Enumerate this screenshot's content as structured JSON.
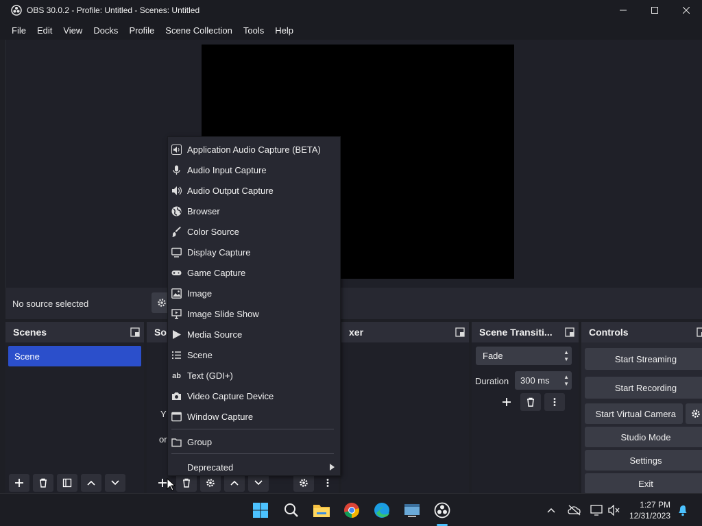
{
  "window": {
    "title": "OBS 30.0.2 - Profile: Untitled - Scenes: Untitled"
  },
  "menu": [
    "File",
    "Edit",
    "View",
    "Docks",
    "Profile",
    "Scene Collection",
    "Tools",
    "Help"
  ],
  "source_bar": {
    "status": "No source selected"
  },
  "docks": {
    "scenes": {
      "title": "Scenes",
      "items": [
        "Scene"
      ]
    },
    "sources": {
      "title_partial": "So",
      "hint_partial_1": "Y",
      "hint_partial_2": "or"
    },
    "mixer": {
      "title_partial": "xer"
    },
    "transitions": {
      "title": "Scene Transiti...",
      "transition": "Fade",
      "duration_label": "Duration",
      "duration_value": "300 ms"
    },
    "controls": {
      "title": "Controls",
      "start_streaming": "Start Streaming",
      "start_recording": "Start Recording",
      "start_virtual_camera": "Start Virtual Camera",
      "studio_mode": "Studio Mode",
      "settings": "Settings",
      "exit": "Exit"
    }
  },
  "context_menu": {
    "items": [
      {
        "label": "Application Audio Capture (BETA)",
        "icon": "speaker-box-icon"
      },
      {
        "label": "Audio Input Capture",
        "icon": "microphone-icon"
      },
      {
        "label": "Audio Output Capture",
        "icon": "speaker-icon"
      },
      {
        "label": "Browser",
        "icon": "globe-icon"
      },
      {
        "label": "Color Source",
        "icon": "brush-icon"
      },
      {
        "label": "Display Capture",
        "icon": "monitor-icon"
      },
      {
        "label": "Game Capture",
        "icon": "gamepad-icon"
      },
      {
        "label": "Image",
        "icon": "image-icon"
      },
      {
        "label": "Image Slide Show",
        "icon": "slideshow-icon"
      },
      {
        "label": "Media Source",
        "icon": "play-icon"
      },
      {
        "label": "Scene",
        "icon": "list-icon"
      },
      {
        "label": "Text (GDI+)",
        "icon": "text-icon"
      },
      {
        "label": "Video Capture Device",
        "icon": "camera-icon"
      },
      {
        "label": "Window Capture",
        "icon": "window-icon"
      }
    ],
    "group": {
      "label": "Group",
      "icon": "folder-icon"
    },
    "deprecated": {
      "label": "Deprecated"
    }
  },
  "taskbar": {
    "time": "1:27 PM",
    "date": "12/31/2023"
  },
  "colors": {
    "accent": "#2b4fcb",
    "panel": "#272831",
    "background": "#1f2028",
    "button": "#3a3c46"
  }
}
